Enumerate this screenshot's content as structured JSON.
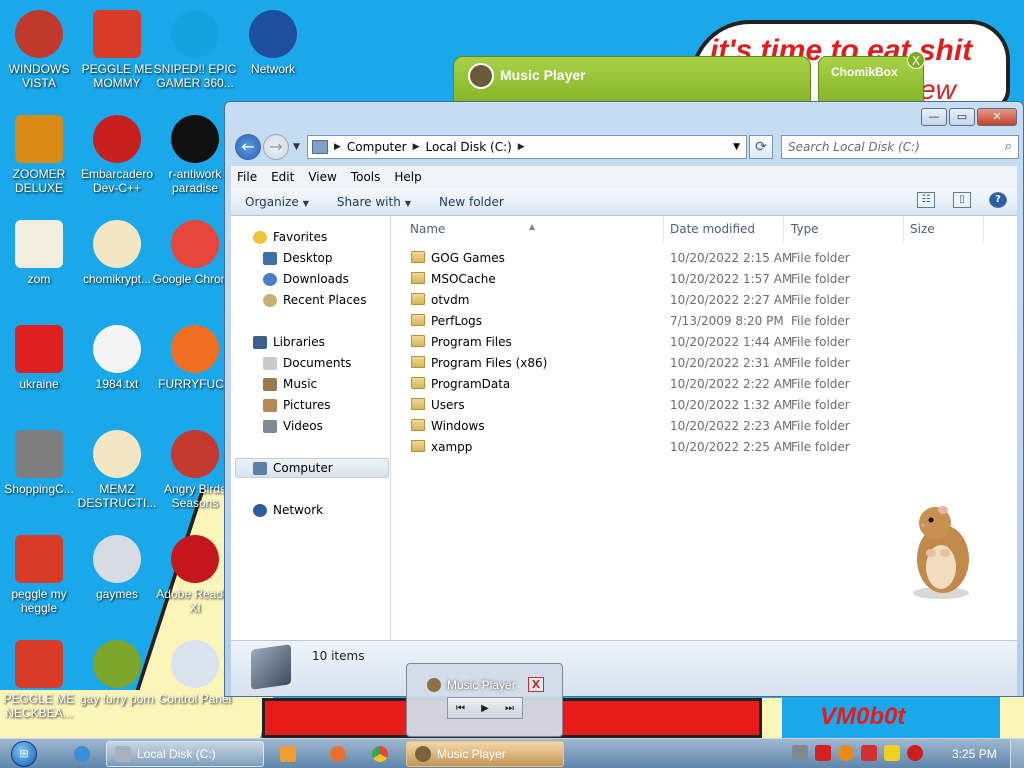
{
  "wallpaper": {
    "text1": "it's time to eat shit",
    "text2": "ew",
    "signature": "VM0b0t"
  },
  "desktop_icons": [
    {
      "label": "WINDOWS VISTA",
      "icon": "vista-icon",
      "color": "#c0392b"
    },
    {
      "label": "PEGGLE ME MOMMY",
      "icon": "peggle-icon",
      "color": "#d73b2a"
    },
    {
      "label": "SNIPED!! EPIC GAMER 360...",
      "icon": "skype-icon",
      "color": "#16a2de"
    },
    {
      "label": "Network",
      "icon": "network-icon",
      "color": "#1d4f9c"
    },
    {
      "label": "ZOOMER DELUXE",
      "icon": "zoomer-icon",
      "color": "#d88a16"
    },
    {
      "label": "Embarcadero Dev-C++",
      "icon": "devcpp-icon",
      "color": "#c8201f"
    },
    {
      "label": "r-antiwork paradise",
      "icon": "antiwork-icon",
      "color": "#111111"
    },
    {
      "label": "zom",
      "icon": "flower-icon",
      "color": "#f2efe0"
    },
    {
      "label": "chomikrypt...",
      "icon": "hourglass-icon",
      "color": "#f3e6c2"
    },
    {
      "label": "Google Chrome",
      "icon": "chrome-icon",
      "color": "#e8453c"
    },
    {
      "label": "ukraine",
      "icon": "radiation-icon",
      "color": "#e02020"
    },
    {
      "label": "1984.txt",
      "icon": "text-file-icon",
      "color": "#f4f4f4"
    },
    {
      "label": "FURRYFUCK",
      "icon": "firefox-icon",
      "color": "#f06f23"
    },
    {
      "label": "ShoppingC...",
      "icon": "flash-icon",
      "color": "#7e7e7e"
    },
    {
      "label": "MEMZ DESTRUCTI...",
      "icon": "hourglass-icon",
      "color": "#f3e6c2"
    },
    {
      "label": "Angry Birds Seasons",
      "icon": "angry-birds-icon",
      "color": "#c53a2e"
    },
    {
      "label": "peggle my heggle",
      "icon": "peggle-icon",
      "color": "#d73b2a"
    },
    {
      "label": "gaymes",
      "icon": "games-folder-icon",
      "color": "#d7dce4"
    },
    {
      "label": "Adobe Reader XI",
      "icon": "adobe-reader-icon",
      "color": "#c4161c"
    },
    {
      "label": "PEGGLE ME NECKBEA...",
      "icon": "peggle-icon",
      "color": "#d73b2a"
    },
    {
      "label": "gay furry porn",
      "icon": "chomikbox-icon",
      "color": "#7ba62a"
    },
    {
      "label": "Control Panel",
      "icon": "control-panel-icon",
      "color": "#d9e3ee"
    }
  ],
  "widgets": {
    "music_player": {
      "title": "Music Player"
    },
    "chomikbox": {
      "title": "ChomikBox",
      "close": "X"
    }
  },
  "explorer": {
    "address": [
      "Computer",
      "Local Disk (C:)"
    ],
    "search_placeholder": "Search Local Disk (C:)",
    "menu": [
      "File",
      "Edit",
      "View",
      "Tools",
      "Help"
    ],
    "toolbar": {
      "organize": "Organize",
      "share_with": "Share with",
      "new_folder": "New folder"
    },
    "nav": {
      "favorites": "Favorites",
      "desktop": "Desktop",
      "downloads": "Downloads",
      "recent_places": "Recent Places",
      "libraries": "Libraries",
      "documents": "Documents",
      "music": "Music",
      "pictures": "Pictures",
      "videos": "Videos",
      "computer": "Computer",
      "network": "Network"
    },
    "columns": {
      "name": "Name",
      "date_modified": "Date modified",
      "type": "Type",
      "size": "Size"
    },
    "rows": [
      {
        "name": "GOG Games",
        "date": "10/20/2022 2:15 AM",
        "type": "File folder"
      },
      {
        "name": "MSOCache",
        "date": "10/20/2022 1:57 AM",
        "type": "File folder"
      },
      {
        "name": "otvdm",
        "date": "10/20/2022 2:27 AM",
        "type": "File folder"
      },
      {
        "name": "PerfLogs",
        "date": "7/13/2009 8:20 PM",
        "type": "File folder"
      },
      {
        "name": "Program Files",
        "date": "10/20/2022 1:44 AM",
        "type": "File folder"
      },
      {
        "name": "Program Files (x86)",
        "date": "10/20/2022 2:31 AM",
        "type": "File folder"
      },
      {
        "name": "ProgramData",
        "date": "10/20/2022 2:22 AM",
        "type": "File folder"
      },
      {
        "name": "Users",
        "date": "10/20/2022 1:32 AM",
        "type": "File folder"
      },
      {
        "name": "Windows",
        "date": "10/20/2022 2:23 AM",
        "type": "File folder"
      },
      {
        "name": "xampp",
        "date": "10/20/2022 2:25 AM",
        "type": "File folder"
      }
    ],
    "item_count": "10 items"
  },
  "thumbnail": {
    "title": "Music Player",
    "close": "X"
  },
  "taskbar": {
    "items": [
      {
        "label": "Local Disk (C:)",
        "icon": "folder-icon"
      },
      {
        "label": "Music Player",
        "icon": "music-player-icon"
      }
    ],
    "clock": "3:25 PM"
  }
}
